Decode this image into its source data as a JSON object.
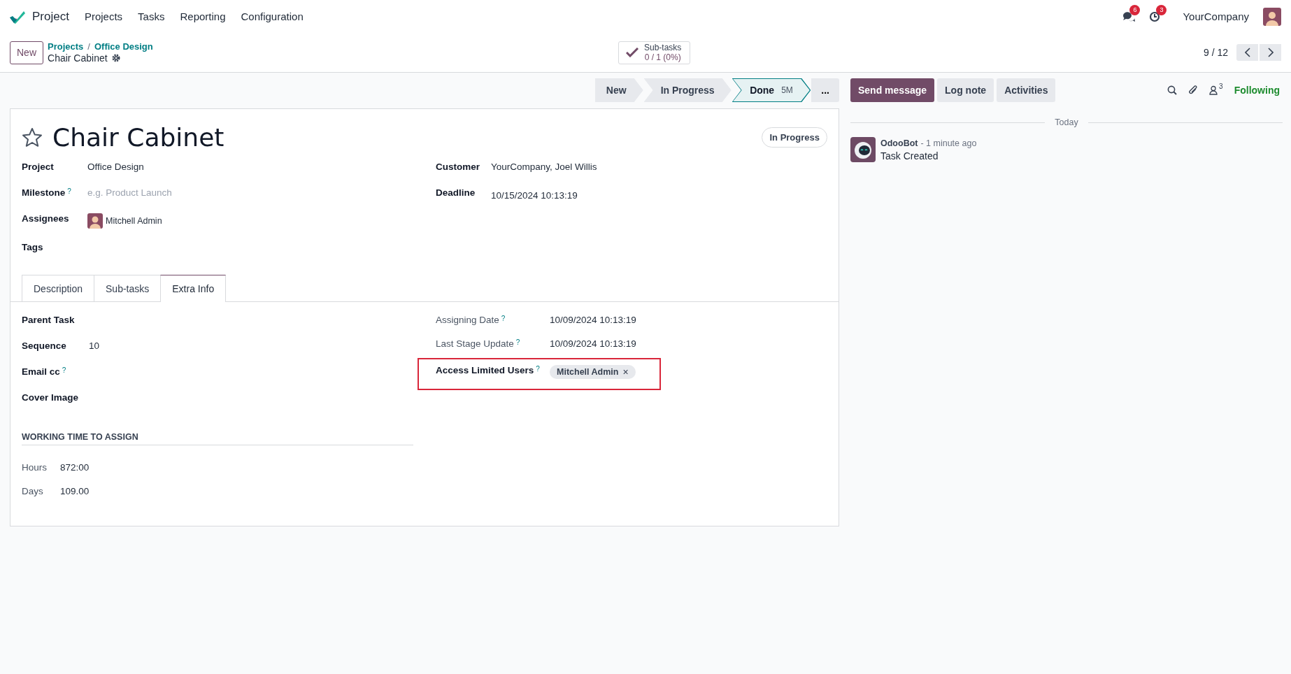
{
  "navbar": {
    "app_name": "Project",
    "menu": [
      "Projects",
      "Tasks",
      "Reporting",
      "Configuration"
    ],
    "messages_badge": "6",
    "activities_badge": "3",
    "company": "YourCompany"
  },
  "control_panel": {
    "new_button": "New",
    "breadcrumbs": [
      "Projects",
      "Office Design"
    ],
    "breadcrumb_separator": "/",
    "record": "Chair Cabinet",
    "subtasks": {
      "label": "Sub-tasks",
      "value": "0 / 1 (0%)"
    },
    "pager": "9 / 12"
  },
  "statusbar": {
    "stages": [
      {
        "label": "New",
        "selected": false
      },
      {
        "label": "In Progress",
        "selected": false
      },
      {
        "label": "Done",
        "badge": "5M",
        "selected": true
      }
    ],
    "more": "..."
  },
  "form": {
    "title": "Chair Cabinet",
    "starred": false,
    "state_button": "In Progress",
    "left_fields": [
      {
        "label": "Project",
        "kind": "text",
        "value": "Office Design"
      },
      {
        "label": "Milestone",
        "help": "?",
        "kind": "placeholder",
        "placeholder": "e.g. Product Launch"
      },
      {
        "label": "Assignees",
        "kind": "avatar",
        "value": "Mitchell Admin"
      },
      {
        "label": "Tags",
        "kind": "empty"
      }
    ],
    "right_fields": [
      {
        "label": "Customer",
        "kind": "text",
        "value": "YourCompany, Joel Willis"
      },
      {
        "label": "Deadline",
        "kind": "text",
        "value": "10/15/2024 10:13:19"
      }
    ],
    "tabs": [
      {
        "label": "Description",
        "selected": false
      },
      {
        "label": "Sub-tasks",
        "selected": false
      },
      {
        "label": "Extra Info",
        "selected": true
      }
    ],
    "extra_info": {
      "left_fields": [
        {
          "label": "Parent Task",
          "kind": "empty"
        },
        {
          "label": "Sequence",
          "kind": "text",
          "value": "10"
        },
        {
          "label": "Email cc",
          "help": "?",
          "kind": "empty"
        },
        {
          "label": "Cover Image",
          "kind": "empty"
        }
      ],
      "right_fields": [
        {
          "label": "Assigning Date",
          "help": "?",
          "kind": "readonly",
          "value": "10/09/2024 10:13:19",
          "highlighted": false
        },
        {
          "label": "Last Stage Update",
          "help": "?",
          "kind": "readonly",
          "value": "10/09/2024 10:13:19",
          "highlighted": false
        },
        {
          "label": "Access Limited Users",
          "help": "?",
          "kind": "tag",
          "value": "Mitchell Admin",
          "remove": "×",
          "highlighted": true
        }
      ],
      "section_title": "WORKING TIME TO ASSIGN",
      "time_fields": [
        {
          "label": "Hours",
          "value": "872:00"
        },
        {
          "label": "Days",
          "value": "109.00"
        }
      ]
    }
  },
  "chatter": {
    "buttons": [
      {
        "label": "Send message",
        "kind": "primary"
      },
      {
        "label": "Log note",
        "kind": "secondary"
      },
      {
        "label": "Activities",
        "kind": "secondary"
      }
    ],
    "followers_count": "3",
    "follow_label": "Following",
    "date_separator": "Today",
    "messages": [
      {
        "author": "OdooBot",
        "time": "- 1 minute ago",
        "body": "Task Created"
      }
    ]
  }
}
